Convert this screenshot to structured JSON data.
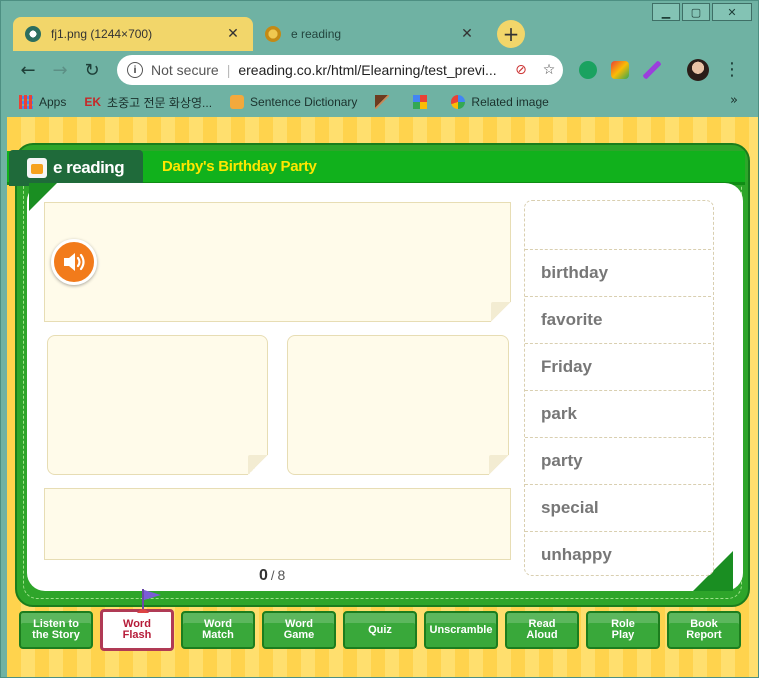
{
  "window": {
    "controls": {
      "minimize": "▁",
      "restore": "▢",
      "close": "✕"
    }
  },
  "tabs": [
    {
      "title": "fj1.png (1244×700)",
      "close": "✕",
      "icon": "globe-icon",
      "active": true
    },
    {
      "title": "e reading",
      "close": "✕",
      "icon": "ereading-favicon",
      "active": false
    }
  ],
  "newtab_label": "+",
  "toolbar": {
    "back": "←",
    "forward": "→",
    "reload": "↻",
    "security": "Not secure",
    "url": "ereading.co.kr/html/Elearning/test_previ...",
    "star": "☆",
    "menu": "⋮"
  },
  "bookmarks": {
    "items": [
      {
        "label": "Apps",
        "icon": "apps-grid-icon"
      },
      {
        "label": "초중고 전문 화상영...",
        "icon": "ek-logo-icon",
        "prefix": "EK"
      },
      {
        "label": "Sentence Dictionary",
        "icon": "dictionary-icon"
      },
      {
        "label": "",
        "icon": "feather-icon"
      },
      {
        "label": "",
        "icon": "pinwheel-icon"
      },
      {
        "label": "Related image",
        "icon": "google-icon"
      }
    ],
    "more": "»"
  },
  "app": {
    "logo": "e reading",
    "title": "Darby's Birthday Party",
    "counter": {
      "current": "0",
      "separator": "/",
      "total": "8"
    },
    "words": [
      "birthday",
      "favorite",
      "Friday",
      "park",
      "party",
      "special",
      "unhappy"
    ],
    "nav_buttons": [
      {
        "line1": "Listen to",
        "line2": "the Story",
        "active": false
      },
      {
        "line1": "Word",
        "line2": "Flash",
        "active": true
      },
      {
        "line1": "Word",
        "line2": "Match",
        "active": false
      },
      {
        "line1": "Word",
        "line2": "Game",
        "active": false
      },
      {
        "line1": "Quiz",
        "line2": "",
        "active": false
      },
      {
        "line1": "Unscramble",
        "line2": "",
        "active": false
      },
      {
        "line1": "Read",
        "line2": "Aloud",
        "active": false
      },
      {
        "line1": "Role",
        "line2": "Play",
        "active": false
      },
      {
        "line1": "Book",
        "line2": "Report",
        "active": false
      }
    ]
  },
  "colors": {
    "chrome": "#6fb2a3",
    "tab_active": "#f2d66a",
    "frame_green": "#2ea52a",
    "header_green": "#11b11c",
    "title_yellow": "#ffe600",
    "speaker_orange": "#f27b1b",
    "active_button_text": "#b61c39"
  }
}
